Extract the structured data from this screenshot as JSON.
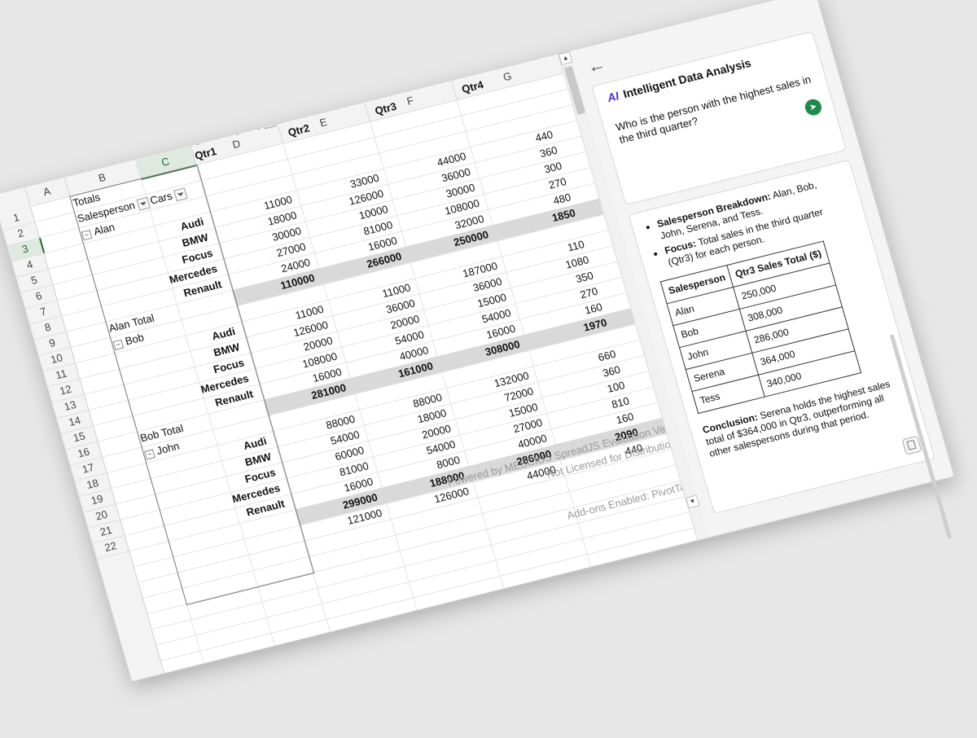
{
  "columns": [
    "A",
    "B",
    "C",
    "D",
    "E",
    "F",
    "G"
  ],
  "rows": [
    "1",
    "2",
    "3",
    "4",
    "5",
    "6",
    "7",
    "8",
    "9",
    "10",
    "11",
    "12",
    "13",
    "14",
    "15",
    "16",
    "17",
    "18",
    "19",
    "20",
    "21",
    "22"
  ],
  "pivot": {
    "totals": "Totals",
    "salesperson_label": "Salesperson",
    "cars_label": "Cars",
    "quarters_label": "Quarters (date)",
    "quarters": [
      "Qtr1",
      "Qtr2",
      "Qtr3",
      "Qtr4"
    ],
    "rows": [
      {
        "type": "group",
        "label": "Alan",
        "cells": [
          "",
          "",
          "",
          ""
        ]
      },
      {
        "type": "item",
        "label": "Audi",
        "cells": [
          "11000",
          "33000",
          "44000",
          "440"
        ]
      },
      {
        "type": "item",
        "label": "BMW",
        "cells": [
          "18000",
          "126000",
          "36000",
          "360"
        ]
      },
      {
        "type": "item",
        "label": "Focus",
        "cells": [
          "30000",
          "10000",
          "30000",
          "300"
        ]
      },
      {
        "type": "item",
        "label": "Mercedes",
        "cells": [
          "27000",
          "81000",
          "108000",
          "270"
        ]
      },
      {
        "type": "item",
        "label": "Renault",
        "cells": [
          "24000",
          "16000",
          "32000",
          "480"
        ]
      },
      {
        "type": "total",
        "label": "Alan Total",
        "cells": [
          "110000",
          "266000",
          "250000",
          "1850"
        ]
      },
      {
        "type": "group",
        "label": "Bob",
        "cells": [
          "",
          "",
          "",
          ""
        ]
      },
      {
        "type": "item",
        "label": "Audi",
        "cells": [
          "11000",
          "11000",
          "187000",
          "110"
        ]
      },
      {
        "type": "item",
        "label": "BMW",
        "cells": [
          "126000",
          "36000",
          "36000",
          "1080"
        ]
      },
      {
        "type": "item",
        "label": "Focus",
        "cells": [
          "20000",
          "20000",
          "15000",
          "350"
        ]
      },
      {
        "type": "item",
        "label": "Mercedes",
        "cells": [
          "108000",
          "54000",
          "54000",
          "270"
        ]
      },
      {
        "type": "item",
        "label": "Renault",
        "cells": [
          "16000",
          "40000",
          "16000",
          "160"
        ]
      },
      {
        "type": "total",
        "label": "Bob Total",
        "cells": [
          "281000",
          "161000",
          "308000",
          "1970"
        ]
      },
      {
        "type": "group",
        "label": "John",
        "cells": [
          "",
          "",
          "",
          ""
        ]
      },
      {
        "type": "item",
        "label": "Audi",
        "cells": [
          "88000",
          "88000",
          "132000",
          "660"
        ]
      },
      {
        "type": "item",
        "label": "BMW",
        "cells": [
          "54000",
          "18000",
          "72000",
          "360"
        ]
      },
      {
        "type": "item",
        "label": "Focus",
        "cells": [
          "60000",
          "20000",
          "15000",
          "100"
        ]
      },
      {
        "type": "item",
        "label": "Mercedes",
        "cells": [
          "81000",
          "54000",
          "27000",
          "810"
        ]
      },
      {
        "type": "item",
        "label": "Renault",
        "cells": [
          "16000",
          "8000",
          "40000",
          "160"
        ]
      },
      {
        "type": "total",
        "label": "",
        "cells": [
          "299000",
          "188000",
          "286000",
          "2090"
        ]
      },
      {
        "type": "item",
        "label": "",
        "cells": [
          "121000",
          "126000",
          "44000",
          "440"
        ]
      }
    ]
  },
  "watermark": {
    "line1": "Powered by MESCIUS SpreadJS Evaluation Version",
    "line2": "Not Licensed for Distribution",
    "line3": "Add-ons Enabled: PivotTable"
  },
  "panel": {
    "back": "←",
    "logo": "AI",
    "title": "Intelligent Data Analysis",
    "prompt": "Who is the person with the highest sales in the third quarter?",
    "send": "➤",
    "bullets": [
      {
        "strong": "Salesperson Breakdown:",
        "text": " Alan, Bob, John, Serena, and Tess."
      },
      {
        "strong": "Focus:",
        "text": " Total sales in the third quarter (Qtr3) for each person."
      }
    ],
    "table": {
      "headers": [
        "Salesperson",
        "Qtr3 Sales Total ($)"
      ],
      "rows": [
        [
          "Alan",
          "250,000"
        ],
        [
          "Bob",
          "308,000"
        ],
        [
          "John",
          "286,000"
        ],
        [
          "Serena",
          "364,000"
        ],
        [
          "Tess",
          "340,000"
        ]
      ]
    },
    "conclusion_strong": "Conclusion:",
    "conclusion_text": " Serena holds the highest sales total of $364,000 in Qtr3, outperforming all other salespersons during that period."
  }
}
